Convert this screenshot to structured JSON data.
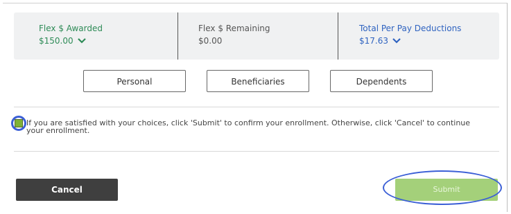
{
  "summary": {
    "flex_awarded": {
      "label": "Flex $ Awarded",
      "value": "$150.00"
    },
    "flex_remaining": {
      "label": "Flex $ Remaining",
      "value": "$0.00"
    },
    "per_pay": {
      "label": "Total Per Pay Deductions",
      "value": "$17.63"
    }
  },
  "tabs": {
    "personal": "Personal",
    "beneficiaries": "Beneficiaries",
    "dependents": "Dependents"
  },
  "confirm": {
    "text": "If you are satisfied with your choices, click 'Submit' to confirm your enrollment. Otherwise, click 'Cancel' to continue your enrollment.",
    "checked": true
  },
  "actions": {
    "cancel": "Cancel",
    "submit": "Submit"
  },
  "colors": {
    "green_label": "#2e8b57",
    "blue_value": "#2f63c0",
    "checkbox_fill": "#7fb236",
    "submit_bg": "#a4d07a",
    "cancel_bg": "#3f3f3f",
    "highlight_ring": "#3b5fd6"
  }
}
